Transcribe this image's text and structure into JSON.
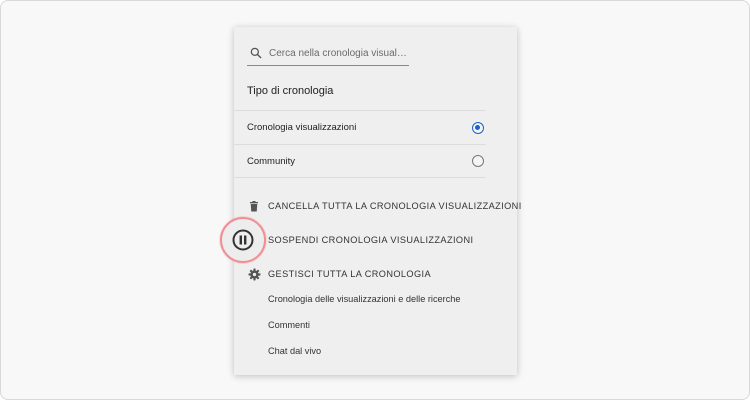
{
  "search": {
    "placeholder": "Cerca nella cronologia visualizz..."
  },
  "history_type": {
    "title": "Tipo di cronologia",
    "options": [
      {
        "label": "Cronologia visualizzazioni",
        "selected": true
      },
      {
        "label": "Community",
        "selected": false
      }
    ]
  },
  "actions": {
    "clear_label": "CANCELLA TUTTA LA CRONOLOGIA VISUALIZZAZIONI",
    "pause_label": "SOSPENDI CRONOLOGIA VISUALIZZAZIONI",
    "manage_label": "GESTISCI TUTTA LA CRONOLOGIA"
  },
  "manage_links": [
    "Cronologia delle visualizzazioni e delle ricerche",
    "Commenti",
    "Chat dal vivo"
  ],
  "icons": {
    "search": "search-icon",
    "clear": "trash-icon",
    "pause": "pause-icon",
    "manage": "gear-icon"
  },
  "colors": {
    "accent": "#1a62c9",
    "highlight_ring": "#ef8f95"
  }
}
